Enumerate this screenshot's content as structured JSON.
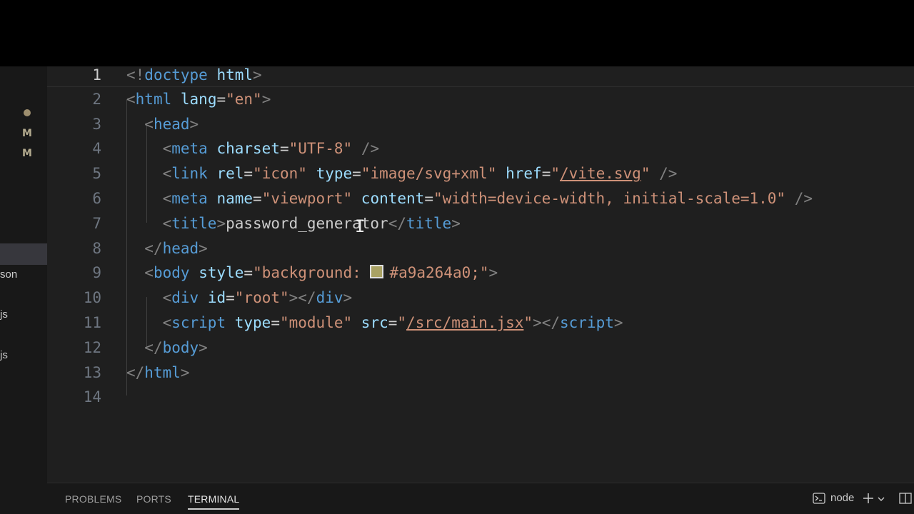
{
  "sidebar": {
    "modified_markers": [
      "M",
      "M"
    ],
    "files": [
      "son",
      "js",
      "js"
    ]
  },
  "editor": {
    "lines": [
      {
        "num": "1",
        "segments": [
          {
            "c": "p",
            "t": "<!"
          },
          {
            "c": "t",
            "t": "doctype"
          },
          {
            "c": "x",
            "t": " "
          },
          {
            "c": "a",
            "t": "html"
          },
          {
            "c": "p",
            "t": ">"
          }
        ]
      },
      {
        "num": "2",
        "segments": [
          {
            "c": "p",
            "t": "<"
          },
          {
            "c": "t",
            "t": "html"
          },
          {
            "c": "x",
            "t": " "
          },
          {
            "c": "a",
            "t": "lang"
          },
          {
            "c": "x",
            "t": "="
          },
          {
            "c": "s",
            "t": "\"en\""
          },
          {
            "c": "p",
            "t": ">"
          }
        ]
      },
      {
        "num": "3",
        "segments": [
          {
            "c": "x",
            "t": "  "
          },
          {
            "c": "p",
            "t": "<"
          },
          {
            "c": "t",
            "t": "head"
          },
          {
            "c": "p",
            "t": ">"
          }
        ]
      },
      {
        "num": "4",
        "segments": [
          {
            "c": "x",
            "t": "    "
          },
          {
            "c": "p",
            "t": "<"
          },
          {
            "c": "t",
            "t": "meta"
          },
          {
            "c": "x",
            "t": " "
          },
          {
            "c": "a",
            "t": "charset"
          },
          {
            "c": "x",
            "t": "="
          },
          {
            "c": "s",
            "t": "\"UTF-8\""
          },
          {
            "c": "x",
            "t": " "
          },
          {
            "c": "p",
            "t": "/>"
          }
        ]
      },
      {
        "num": "5",
        "segments": [
          {
            "c": "x",
            "t": "    "
          },
          {
            "c": "p",
            "t": "<"
          },
          {
            "c": "t",
            "t": "link"
          },
          {
            "c": "x",
            "t": " "
          },
          {
            "c": "a",
            "t": "rel"
          },
          {
            "c": "x",
            "t": "="
          },
          {
            "c": "s",
            "t": "\"icon\""
          },
          {
            "c": "x",
            "t": " "
          },
          {
            "c": "a",
            "t": "type"
          },
          {
            "c": "x",
            "t": "="
          },
          {
            "c": "s",
            "t": "\"image/svg+xml\""
          },
          {
            "c": "x",
            "t": " "
          },
          {
            "c": "a",
            "t": "href"
          },
          {
            "c": "x",
            "t": "="
          },
          {
            "c": "s",
            "t": "\""
          },
          {
            "c": "s u",
            "t": "/vite.svg"
          },
          {
            "c": "s",
            "t": "\""
          },
          {
            "c": "x",
            "t": " "
          },
          {
            "c": "p",
            "t": "/>"
          }
        ]
      },
      {
        "num": "6",
        "segments": [
          {
            "c": "x",
            "t": "    "
          },
          {
            "c": "p",
            "t": "<"
          },
          {
            "c": "t",
            "t": "meta"
          },
          {
            "c": "x",
            "t": " "
          },
          {
            "c": "a",
            "t": "name"
          },
          {
            "c": "x",
            "t": "="
          },
          {
            "c": "s",
            "t": "\"viewport\""
          },
          {
            "c": "x",
            "t": " "
          },
          {
            "c": "a",
            "t": "content"
          },
          {
            "c": "x",
            "t": "="
          },
          {
            "c": "s",
            "t": "\"width=device-width, initial-scale=1.0\""
          },
          {
            "c": "x",
            "t": " "
          },
          {
            "c": "p",
            "t": "/>"
          }
        ]
      },
      {
        "num": "7",
        "segments": [
          {
            "c": "x",
            "t": "    "
          },
          {
            "c": "p",
            "t": "<"
          },
          {
            "c": "t",
            "t": "title"
          },
          {
            "c": "p",
            "t": ">"
          },
          {
            "c": "x",
            "t": "password_generator"
          },
          {
            "c": "p",
            "t": "</"
          },
          {
            "c": "t",
            "t": "title"
          },
          {
            "c": "p",
            "t": ">"
          }
        ]
      },
      {
        "num": "8",
        "segments": [
          {
            "c": "x",
            "t": "  "
          },
          {
            "c": "p",
            "t": "</"
          },
          {
            "c": "t",
            "t": "head"
          },
          {
            "c": "p",
            "t": ">"
          }
        ]
      },
      {
        "num": "9",
        "segments": [
          {
            "c": "x",
            "t": "  "
          },
          {
            "c": "p",
            "t": "<"
          },
          {
            "c": "t",
            "t": "body"
          },
          {
            "c": "x",
            "t": " "
          },
          {
            "c": "a",
            "t": "style"
          },
          {
            "c": "x",
            "t": "="
          },
          {
            "c": "s",
            "t": "\"background: "
          },
          {
            "c": "swatch",
            "t": ""
          },
          {
            "c": "s",
            "t": "#a9a264a0;\""
          },
          {
            "c": "p",
            "t": ">"
          }
        ]
      },
      {
        "num": "10",
        "segments": [
          {
            "c": "x",
            "t": "    "
          },
          {
            "c": "p",
            "t": "<"
          },
          {
            "c": "t",
            "t": "div"
          },
          {
            "c": "x",
            "t": " "
          },
          {
            "c": "a",
            "t": "id"
          },
          {
            "c": "x",
            "t": "="
          },
          {
            "c": "s",
            "t": "\"root\""
          },
          {
            "c": "p",
            "t": "></"
          },
          {
            "c": "t",
            "t": "div"
          },
          {
            "c": "p",
            "t": ">"
          }
        ]
      },
      {
        "num": "11",
        "segments": [
          {
            "c": "x",
            "t": "    "
          },
          {
            "c": "p",
            "t": "<"
          },
          {
            "c": "t",
            "t": "script"
          },
          {
            "c": "x",
            "t": " "
          },
          {
            "c": "a",
            "t": "type"
          },
          {
            "c": "x",
            "t": "="
          },
          {
            "c": "s",
            "t": "\"module\""
          },
          {
            "c": "x",
            "t": " "
          },
          {
            "c": "a",
            "t": "src"
          },
          {
            "c": "x",
            "t": "="
          },
          {
            "c": "s",
            "t": "\""
          },
          {
            "c": "s u",
            "t": "/src/main.jsx"
          },
          {
            "c": "s",
            "t": "\""
          },
          {
            "c": "p",
            "t": "></"
          },
          {
            "c": "t",
            "t": "script"
          },
          {
            "c": "p",
            "t": ">"
          }
        ]
      },
      {
        "num": "12",
        "segments": [
          {
            "c": "x",
            "t": "  "
          },
          {
            "c": "p",
            "t": "</"
          },
          {
            "c": "t",
            "t": "body"
          },
          {
            "c": "p",
            "t": ">"
          }
        ]
      },
      {
        "num": "13",
        "segments": [
          {
            "c": "p",
            "t": "</"
          },
          {
            "c": "t",
            "t": "html"
          },
          {
            "c": "p",
            "t": ">"
          }
        ]
      },
      {
        "num": "14",
        "segments": []
      }
    ],
    "swatch_color": "#a9a264"
  },
  "panel": {
    "tabs": [
      {
        "label": "PROBLEMS",
        "active": false
      },
      {
        "label": "PORTS",
        "active": false
      },
      {
        "label": "TERMINAL",
        "active": true
      }
    ],
    "terminal_name": "node",
    "icons": [
      "terminal-icon",
      "plus-icon",
      "chevron-down-icon",
      "split-panel-icon"
    ]
  }
}
